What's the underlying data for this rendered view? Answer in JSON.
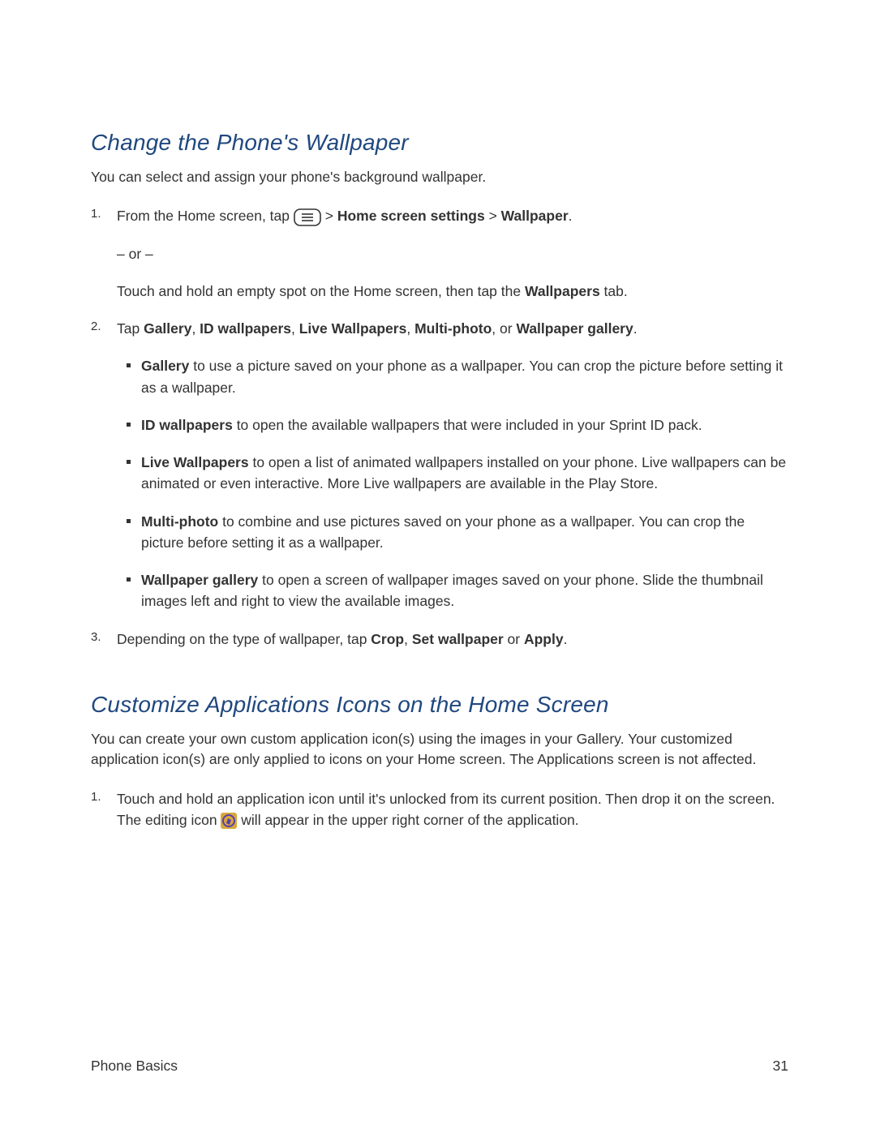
{
  "section1": {
    "heading": "Change the Phone's Wallpaper",
    "intro": "You can select and assign your phone's background wallpaper.",
    "step1": {
      "pre": "From the Home screen, tap ",
      "mid": " > ",
      "bold1": "Home screen settings",
      "sep": " > ",
      "bold2": "Wallpaper",
      "post": "."
    },
    "or": "– or –",
    "step1b": {
      "pre": "Touch and hold an empty spot on the Home screen, then tap the ",
      "bold": "Wallpapers",
      "post": " tab."
    },
    "step2": {
      "pre": "Tap ",
      "b1": "Gallery",
      "s1": ", ",
      "b2": "ID wallpapers",
      "s2": ", ",
      "b3": "Live Wallpapers",
      "s3": ", ",
      "b4": "Multi-photo",
      "s4": ", or ",
      "b5": "Wallpaper gallery",
      "post": "."
    },
    "bullets": {
      "gallery": {
        "b": "Gallery",
        "t": " to use a picture saved on your phone as a wallpaper. You can crop the picture before setting it as a wallpaper."
      },
      "id": {
        "b": "ID wallpapers",
        "t": " to open the available wallpapers that were included in your Sprint ID pack."
      },
      "live": {
        "b": "Live Wallpapers",
        "t": " to open a list of animated wallpapers installed on your phone. Live wallpapers can be animated or even interactive. More Live wallpapers are available in the Play Store."
      },
      "multi": {
        "b": "Multi-photo",
        "t": " to combine and use pictures saved on your phone as a wallpaper. You can crop the picture before setting it as a wallpaper."
      },
      "wg": {
        "b": "Wallpaper gallery",
        "t": " to open a screen of wallpaper images saved on your phone. Slide the thumbnail images left and right to view the available images."
      }
    },
    "step3": {
      "pre": "Depending on the type of wallpaper, tap ",
      "b1": "Crop",
      "s1": ", ",
      "b2": "Set wallpaper",
      "s2": " or ",
      "b3": "Apply",
      "post": "."
    }
  },
  "section2": {
    "heading": "Customize Applications Icons on the Home Screen",
    "intro": "You can create your own custom application icon(s) using the images in your Gallery. Your customized application icon(s) are only applied to icons on your Home screen. The Applications screen is not affected.",
    "step1": {
      "pre": "Touch and hold an application icon until it's unlocked from its current position. Then drop it on the screen. The editing icon ",
      "post": " will appear in the upper right corner of the application."
    }
  },
  "footer": {
    "left": "Phone Basics",
    "right": "31"
  }
}
